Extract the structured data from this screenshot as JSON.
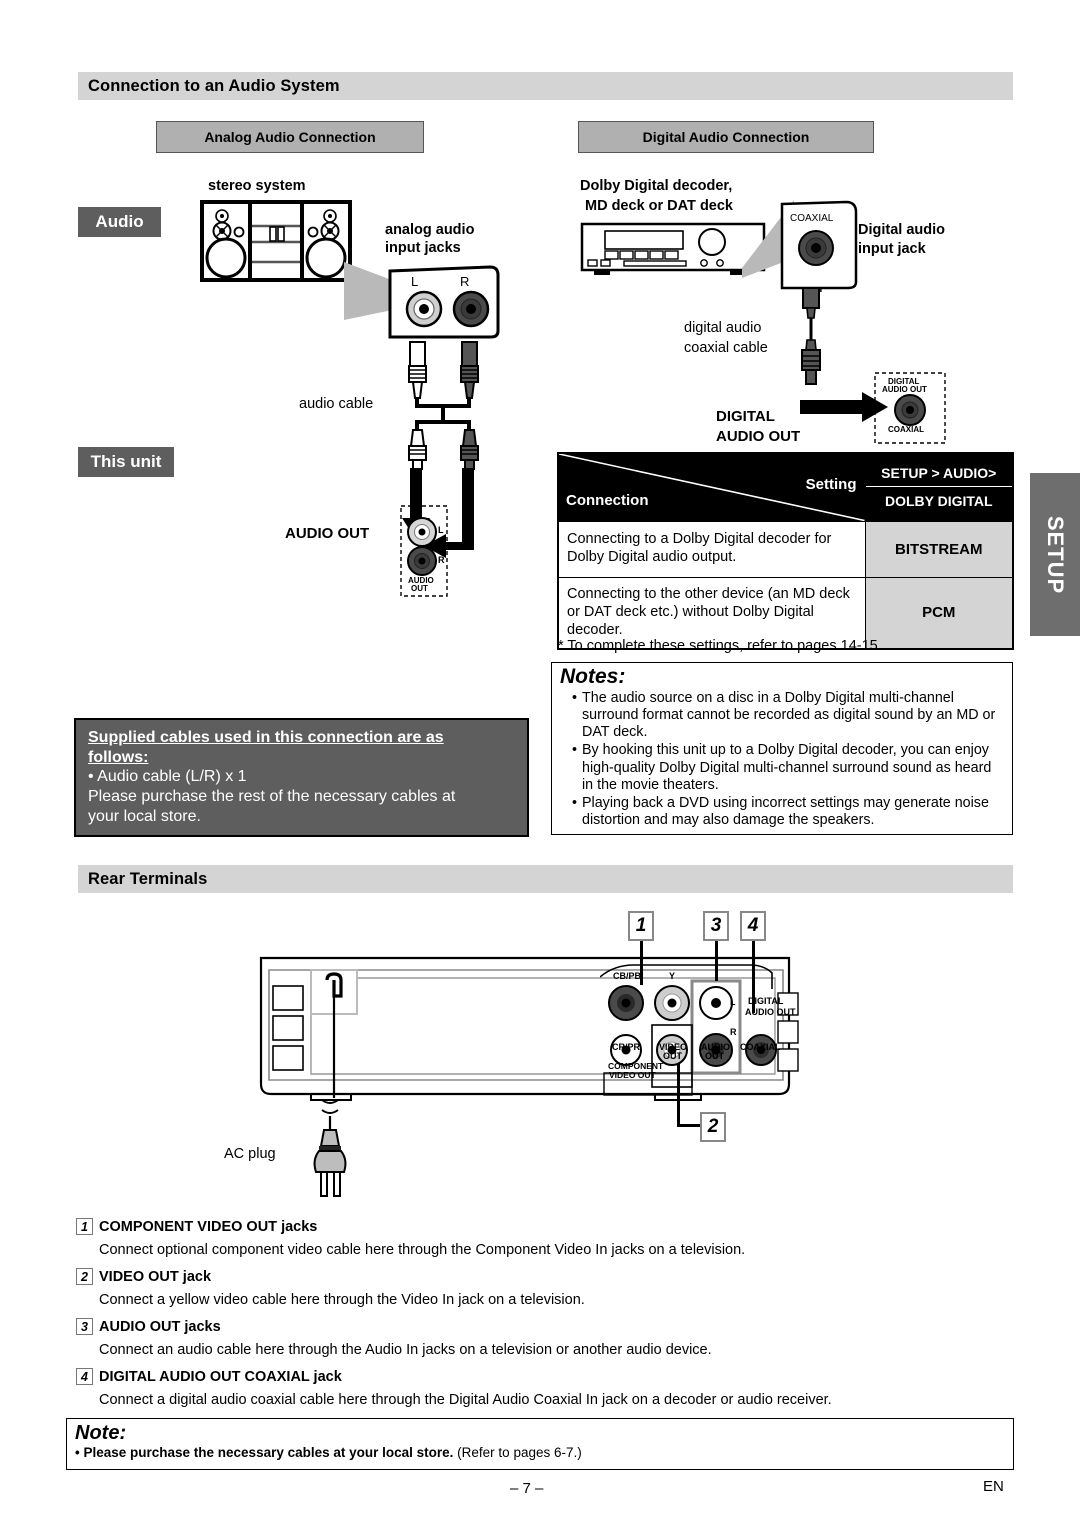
{
  "sections": {
    "audio_system_title": "Connection to an Audio System",
    "rear_terminals_title": "Rear Terminals"
  },
  "subheads": {
    "analog": "Analog Audio Connection",
    "digital": "Digital Audio Connection"
  },
  "tags": {
    "audio": "Audio",
    "this_unit": "This unit",
    "setup_tab": "SETUP"
  },
  "analog_diagram": {
    "device_label": "stereo system",
    "input_jacks_label_line1": "analog audio",
    "input_jacks_label_line2": "input jacks",
    "jack_l": "L",
    "jack_r": "R",
    "cable_label": "audio cable",
    "unit_jack_label": "AUDIO OUT",
    "unit_jack_l": "L",
    "unit_jack_r": "R",
    "unit_jack_tiny_1": "AUDIO",
    "unit_jack_tiny_2": "OUT"
  },
  "digital_diagram": {
    "device_label_line1": "Dolby Digital decoder,",
    "device_label_line2": "MD deck or DAT deck",
    "coaxial_label": "COAXIAL",
    "input_jack_line1": "Digital audio",
    "input_jack_line2": "input jack",
    "cable_label_line1": "digital audio",
    "cable_label_line2": "coaxial cable",
    "out_label_line1": "DIGITAL",
    "out_label_line2": "AUDIO OUT",
    "jack_tiny_1": "DIGITAL",
    "jack_tiny_2": "AUDIO OUT",
    "jack_tiny_3": "COAXIAL"
  },
  "setting_table": {
    "header_setting": "Setting",
    "header_connection": "Connection",
    "header_right_line1": "SETUP > AUDIO>",
    "header_right_line2": "DOLBY DIGITAL",
    "rows": [
      {
        "connection": "Connecting to a Dolby Digital decoder for Dolby Digital audio output.",
        "setting": "BITSTREAM"
      },
      {
        "connection": "Connecting to the other device (an MD deck or DAT deck etc.) without Dolby Digital decoder.",
        "setting": "PCM"
      }
    ],
    "footnote": "* To complete these settings, refer to pages 14-15."
  },
  "notes_box": {
    "title": "Notes:",
    "items": [
      "The audio source on a disc in a Dolby Digital multi-channel surround format cannot be recorded as digital sound by an MD or DAT deck.",
      "By hooking this unit up to a Dolby Digital decoder, you can enjoy high-quality Dolby Digital multi-channel surround sound as heard in the movie theaters.",
      "Playing back a DVD using incorrect settings may generate noise distortion and may also damage the speakers."
    ]
  },
  "supplied_cables": {
    "heading_line1": "Supplied cables used in this connection are as",
    "heading_line2": "follows:",
    "bullet": "• Audio cable (L/R) x 1",
    "text_line1": "Please purchase the rest of the necessary cables at",
    "text_line2": "your local store."
  },
  "rear_panel": {
    "callouts": [
      "1",
      "3",
      "4",
      "2"
    ],
    "jack_labels": {
      "cb_pb": "CB/PB",
      "y": "Y",
      "cr_pr": "CR/PR",
      "component_line1": "COMPONENT",
      "component_line2": "VIDEO OUT",
      "video_out_line1": "VIDEO",
      "video_out_line2": "OUT",
      "audio_out_line1": "AUDIO",
      "audio_out_line2": "OUT",
      "audio_l": "L",
      "audio_r": "R",
      "digital_line1": "DIGITAL",
      "digital_line2": "AUDIO OUT",
      "coaxial": "COAXIAL"
    },
    "ac_plug_label": "AC plug"
  },
  "terminal_items": [
    {
      "num": "1",
      "title": "COMPONENT VIDEO OUT jacks",
      "text": "Connect optional component video cable here through the Component Video In jacks on a television."
    },
    {
      "num": "2",
      "title": "VIDEO OUT jack",
      "text": "Connect a yellow video cable here through the Video In jack on a television."
    },
    {
      "num": "3",
      "title": "AUDIO OUT jacks",
      "text": "Connect an audio cable here through the Audio In jacks on a television or another audio device."
    },
    {
      "num": "4",
      "title": "DIGITAL AUDIO OUT COAXIAL jack",
      "text": "Connect a digital audio coaxial cable here through the Digital Audio Coaxial In jack on a decoder or audio receiver."
    }
  ],
  "bottom_note": {
    "title": "Note:",
    "bullet_bold": "• Please purchase the necessary cables at your local store.",
    "bullet_rest": " (Refer to pages 6-7.)"
  },
  "footer": {
    "page_number": "– 7 –",
    "lang": "EN"
  }
}
